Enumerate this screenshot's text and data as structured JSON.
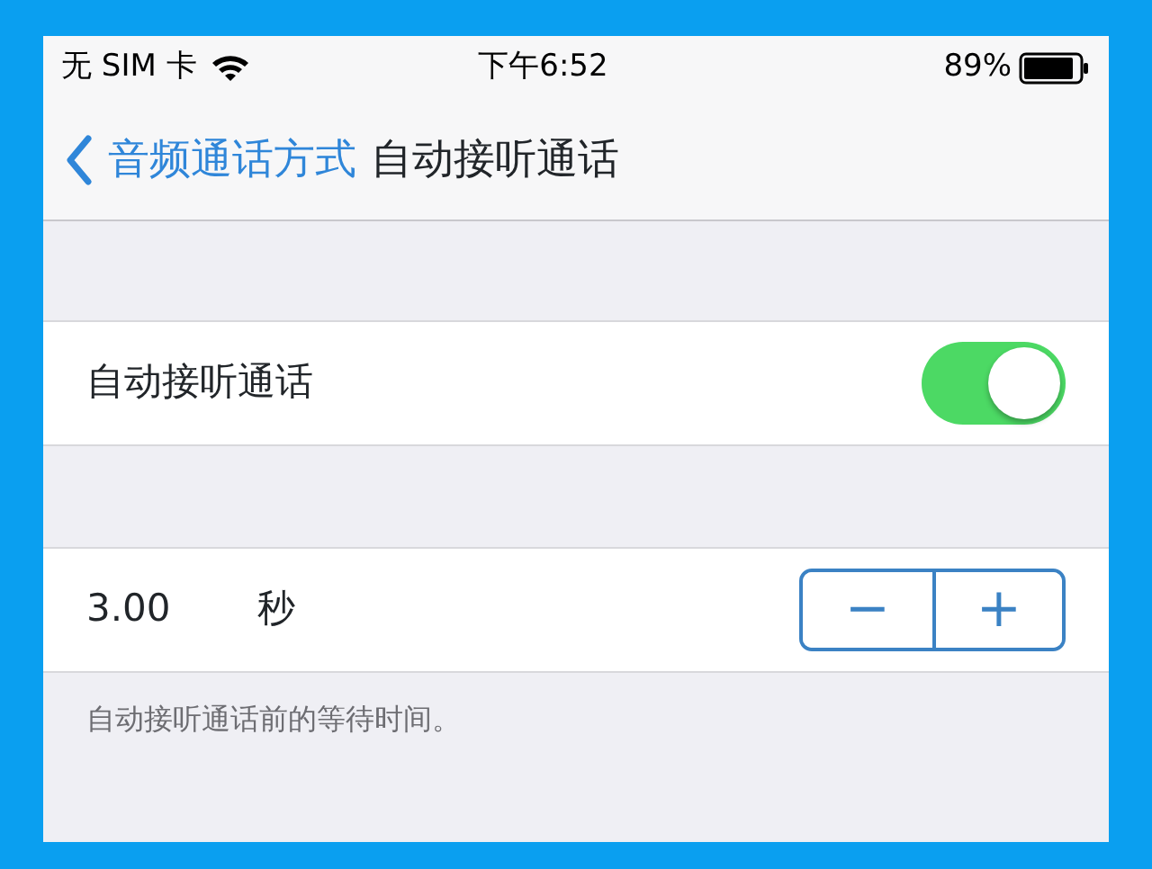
{
  "status_bar": {
    "carrier": "无 SIM 卡",
    "time": "下午6:52",
    "battery": "89%"
  },
  "nav": {
    "back": "音频通话方式",
    "title": "自动接听通话"
  },
  "toggle_row": {
    "label": "自动接听通话",
    "on": true
  },
  "stepper_row": {
    "value": "3.00",
    "unit": "秒",
    "minus": "−",
    "plus": "+"
  },
  "footer": "自动接听通话前的等待时间。"
}
